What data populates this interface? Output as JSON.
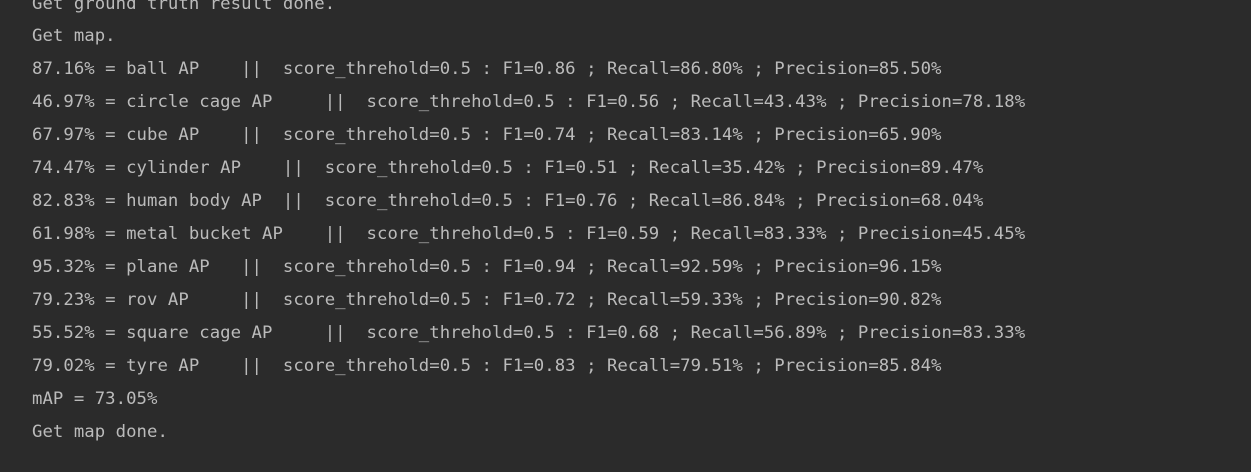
{
  "console": {
    "lines": [
      "Get ground truth result done.",
      "Get map.",
      "87.16% = ball AP    ||  score_threhold=0.5 : F1=0.86 ; Recall=86.80% ; Precision=85.50%",
      "46.97% = circle cage AP     ||  score_threhold=0.5 : F1=0.56 ; Recall=43.43% ; Precision=78.18%",
      "67.97% = cube AP    ||  score_threhold=0.5 : F1=0.74 ; Recall=83.14% ; Precision=65.90%",
      "74.47% = cylinder AP    ||  score_threhold=0.5 : F1=0.51 ; Recall=35.42% ; Precision=89.47%",
      "82.83% = human body AP  ||  score_threhold=0.5 : F1=0.76 ; Recall=86.84% ; Precision=68.04%",
      "61.98% = metal bucket AP    ||  score_threhold=0.5 : F1=0.59 ; Recall=83.33% ; Precision=45.45%",
      "95.32% = plane AP   ||  score_threhold=0.5 : F1=0.94 ; Recall=92.59% ; Precision=96.15%",
      "79.23% = rov AP     ||  score_threhold=0.5 : F1=0.72 ; Recall=59.33% ; Precision=90.82%",
      "55.52% = square cage AP     ||  score_threhold=0.5 : F1=0.68 ; Recall=56.89% ; Precision=83.33%",
      "79.02% = tyre AP    ||  score_threhold=0.5 : F1=0.83 ; Recall=79.51% ; Precision=85.84%",
      "mAP = 73.05%",
      "Get map done."
    ]
  },
  "colors": {
    "background": "#2b2b2b",
    "text": "#bbbbbb"
  }
}
